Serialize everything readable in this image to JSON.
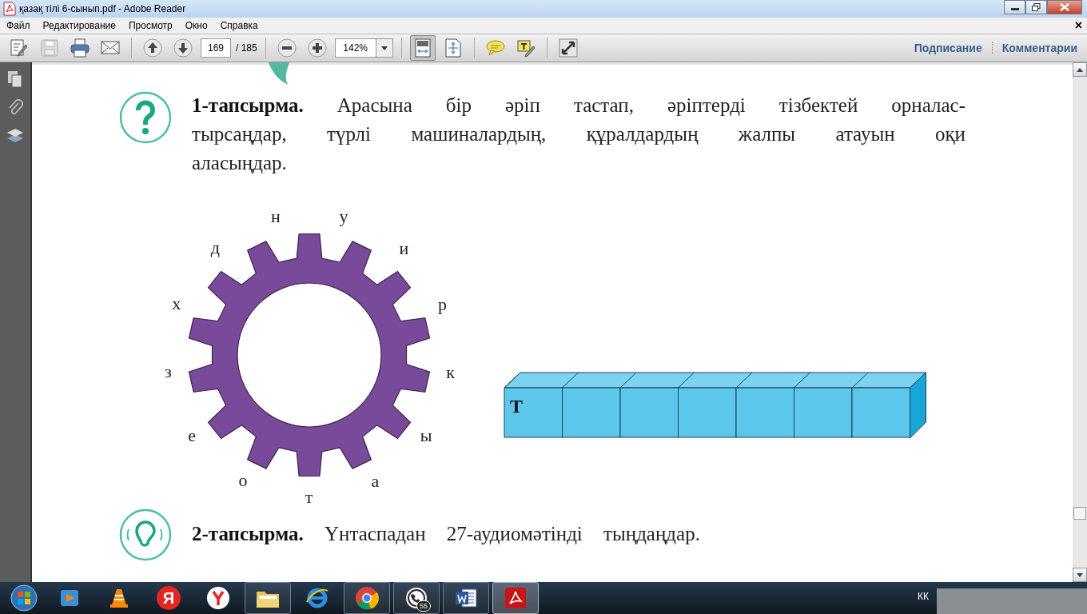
{
  "window": {
    "title": "қазақ тілі 6-сынып.pdf - Adobe Reader"
  },
  "menu_bar": {
    "items": [
      "Файл",
      "Редактирование",
      "Просмотр",
      "Окно",
      "Справка"
    ],
    "close": "×"
  },
  "toolbar": {
    "tools": [
      {
        "kind": "edit",
        "disabled": false
      },
      {
        "kind": "save",
        "disabled": true
      },
      {
        "kind": "print",
        "disabled": false
      },
      {
        "kind": "mail",
        "disabled": false
      }
    ],
    "page": "169",
    "page_total": "/ 185",
    "zoom": "142%",
    "view_buttons": [
      {
        "kind": "fit-page",
        "selected": true
      },
      {
        "kind": "fit-width",
        "selected": false
      }
    ],
    "panels": [
      "Подписание",
      "Комментарии"
    ]
  },
  "document": {
    "task_1": "**1-тапсырма.** Арасына бір әріп тастап, әріптерді тізбектей орналас-тырсаңдар, түрлі машиналардың, құралдардың жалпы атауын оқи аласыңдар.",
    "letters": [
      "н",
      "у",
      "и",
      "р",
      "к",
      "ы",
      "а",
      "т",
      "о",
      "е",
      "з",
      "х",
      "д"
    ],
    "answer_cells": [
      {
        "kind": "filled",
        "text": "Т"
      },
      {
        "kind": "empty"
      },
      {
        "kind": "empty"
      },
      {
        "kind": "empty"
      },
      {
        "kind": "empty"
      },
      {
        "kind": "empty"
      },
      {
        "kind": "empty"
      }
    ],
    "task_2": "**2-тапсырма.** Үнтаспадан 27-аудиомәтінді тыңдаңдар."
  },
  "taskbar": {
    "apps": [
      {
        "kind": "player",
        "open": false,
        "selected": false
      },
      {
        "kind": "cone",
        "open": false,
        "selected": false
      },
      {
        "kind": "letter",
        "label": "Я",
        "open": false,
        "selected": false
      },
      {
        "kind": "ybrowser",
        "open": false,
        "selected": false
      },
      {
        "kind": "folder",
        "open": true,
        "selected": false
      },
      {
        "kind": "ie",
        "open": false,
        "selected": false
      },
      {
        "kind": "chrome",
        "open": true,
        "selected": false
      },
      {
        "kind": "phone",
        "badge": "55",
        "open": true,
        "selected": false
      },
      {
        "kind": "word",
        "open": true,
        "selected": false
      },
      {
        "kind": "acrobat",
        "open": true,
        "selected": true
      }
    ],
    "language": "КК"
  }
}
